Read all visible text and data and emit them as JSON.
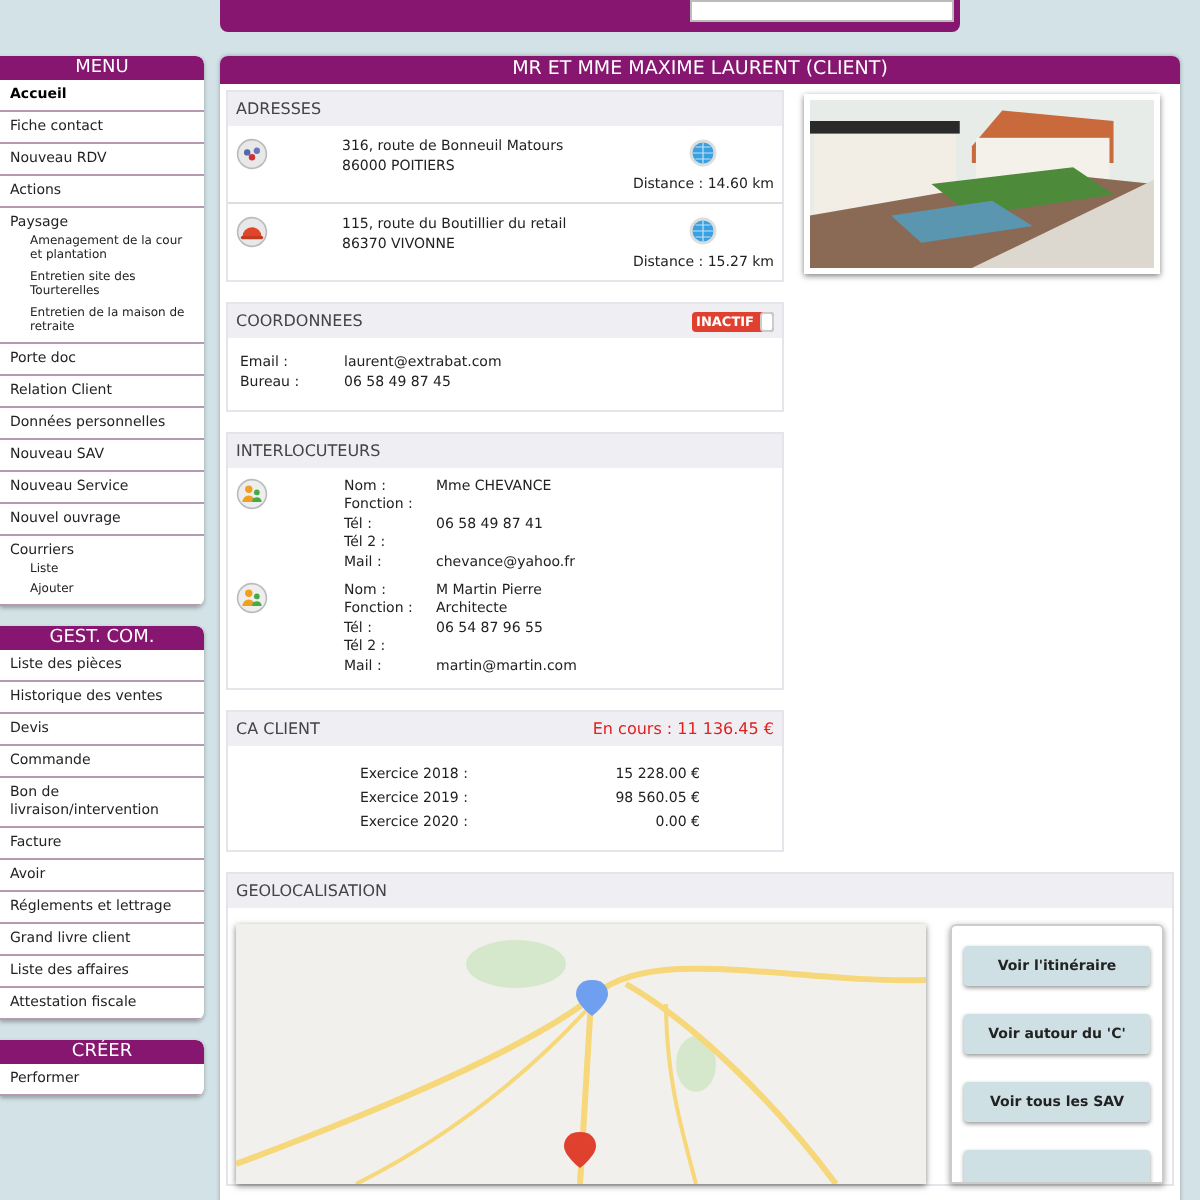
{
  "sidebar": {
    "menus": [
      {
        "title": "MENU",
        "items": [
          {
            "label": "Accueil",
            "selected": true
          },
          {
            "label": "Fiche contact",
            "selected": false
          },
          {
            "label": "Nouveau RDV",
            "selected": false
          },
          {
            "label": "Actions",
            "selected": false
          },
          {
            "label": "Paysage",
            "selected": false,
            "children": [
              {
                "label": "Amenagement de la cour et plantation"
              },
              {
                "label": "Entretien site des Tourterelles"
              },
              {
                "label": "Entretien de la maison de retraite"
              }
            ]
          },
          {
            "label": "Porte doc",
            "selected": false
          },
          {
            "label": "Relation Client",
            "selected": false
          },
          {
            "label": "Données personnelles",
            "selected": false
          },
          {
            "label": "Nouveau SAV",
            "selected": false
          },
          {
            "label": "Nouveau Service",
            "selected": false
          },
          {
            "label": "Nouvel ouvrage",
            "selected": false
          },
          {
            "label": "Courriers",
            "selected": false,
            "children": [
              {
                "label": "Liste"
              },
              {
                "label": "Ajouter"
              }
            ]
          }
        ]
      },
      {
        "title": "GEST. COM.",
        "items": [
          {
            "label": "Liste des pièces",
            "selected": false
          },
          {
            "label": "Historique des ventes",
            "selected": false
          },
          {
            "label": "Devis",
            "selected": false
          },
          {
            "label": "Commande",
            "selected": false
          },
          {
            "label": "Bon de livraison/intervention",
            "selected": false
          },
          {
            "label": "Facture",
            "selected": false
          },
          {
            "label": "Avoir",
            "selected": false
          },
          {
            "label": "Réglements et lettrage",
            "selected": false
          },
          {
            "label": "Grand livre client",
            "selected": false
          },
          {
            "label": "Liste des affaires",
            "selected": false
          },
          {
            "label": "Attestation fiscale",
            "selected": false
          }
        ]
      },
      {
        "title": "CRÉER",
        "items": [
          {
            "label": "Performer",
            "selected": false
          }
        ]
      }
    ]
  },
  "client": {
    "title": "MR ET MME MAXIME LAURENT (CLIENT)"
  },
  "addresses": {
    "title": "ADRESSES",
    "items": [
      {
        "kind": "office",
        "line1": "316, route de Bonneuil Matours",
        "line2": "86000 POITIERS",
        "distance": "Distance : 14.60 km"
      },
      {
        "kind": "site",
        "line1": "115, route du Boutillier du retail",
        "line2": "86370 VIVONNE",
        "distance": "Distance : 15.27 km"
      }
    ]
  },
  "coordonnees": {
    "title": "COORDONNEES",
    "status": {
      "label": "INACTIF",
      "on": false
    },
    "rows": [
      {
        "label": "Email :",
        "value": "laurent@extrabat.com"
      },
      {
        "label": "Bureau :",
        "value": "06 58 49 87 45"
      }
    ]
  },
  "interlocuteurs": {
    "title": "INTERLOCUTEURS",
    "contacts": [
      {
        "fields": [
          {
            "label": "Nom :",
            "value": "Mme CHEVANCE"
          },
          {
            "label": "Fonction :"
          },
          {
            "label": "Tél :",
            "value": "06 58 49 87 41"
          },
          {
            "label": "Tél 2 :"
          },
          {
            "label": "Mail :",
            "value": "chevance@yahoo.fr"
          }
        ]
      },
      {
        "fields": [
          {
            "label": "Nom :",
            "value": "M Martin Pierre"
          },
          {
            "label": "Fonction :",
            "value": "Architecte"
          },
          {
            "label": "Tél :",
            "value": "06 54 87 96 55"
          },
          {
            "label": "Tél 2 :"
          },
          {
            "label": "Mail :",
            "value": "martin@martin.com"
          }
        ]
      }
    ]
  },
  "ca_client": {
    "title": "CA CLIENT",
    "current": "En cours : 11 136.45 €",
    "rows": [
      {
        "label": "Exercice 2018 :",
        "value": "15 228.00 €"
      },
      {
        "label": "Exercice 2019 :",
        "value": "98 560.05 €"
      },
      {
        "label": "Exercice 2020 :",
        "value": "0.00 €"
      }
    ]
  },
  "geolocalisation": {
    "title": "GEOLOCALISATION",
    "buttons": [
      "Voir l'itinéraire",
      "Voir autour du 'C'",
      "Voir tous les SAV"
    ]
  }
}
